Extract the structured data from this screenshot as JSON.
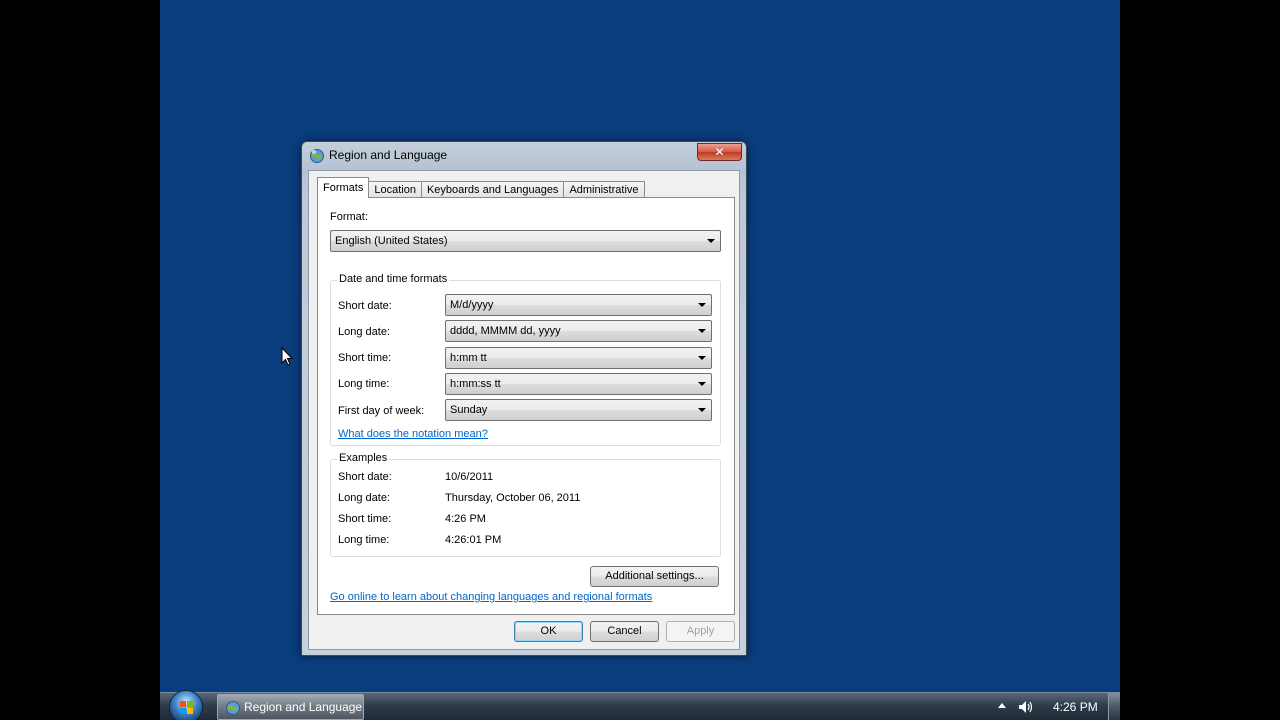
{
  "window": {
    "title": "Region and Language",
    "close_glyph": "✕"
  },
  "tabs": [
    {
      "label": "Formats",
      "active": true
    },
    {
      "label": "Location",
      "active": false
    },
    {
      "label": "Keyboards and Languages",
      "active": false
    },
    {
      "label": "Administrative",
      "active": false
    }
  ],
  "formats": {
    "format_label": "Format:",
    "format_value": "English (United States)",
    "date_time_group": {
      "title": "Date and time formats",
      "short_date_label": "Short date:",
      "short_date_value": "M/d/yyyy",
      "long_date_label": "Long date:",
      "long_date_value": "dddd, MMMM dd, yyyy",
      "short_time_label": "Short time:",
      "short_time_value": "h:mm tt",
      "long_time_label": "Long time:",
      "long_time_value": "h:mm:ss tt",
      "first_day_label": "First day of week:",
      "first_day_value": "Sunday",
      "notation_link": "What does the notation mean?"
    },
    "examples_group": {
      "title": "Examples",
      "short_date_label": "Short date:",
      "short_date_value": "10/6/2011",
      "long_date_label": "Long date:",
      "long_date_value": "Thursday, October 06, 2011",
      "short_time_label": "Short time:",
      "short_time_value": "4:26 PM",
      "long_time_label": "Long time:",
      "long_time_value": "4:26:01 PM"
    },
    "additional_settings_label": "Additional settings...",
    "online_link": "Go online to learn about changing languages and regional formats"
  },
  "buttons": {
    "ok": "OK",
    "cancel": "Cancel",
    "apply": "Apply"
  },
  "taskbar": {
    "task_label": "Region and Language",
    "clock": "4:26 PM"
  },
  "colors": {
    "desktop": "#0a3d7d",
    "link": "#0066cc"
  }
}
